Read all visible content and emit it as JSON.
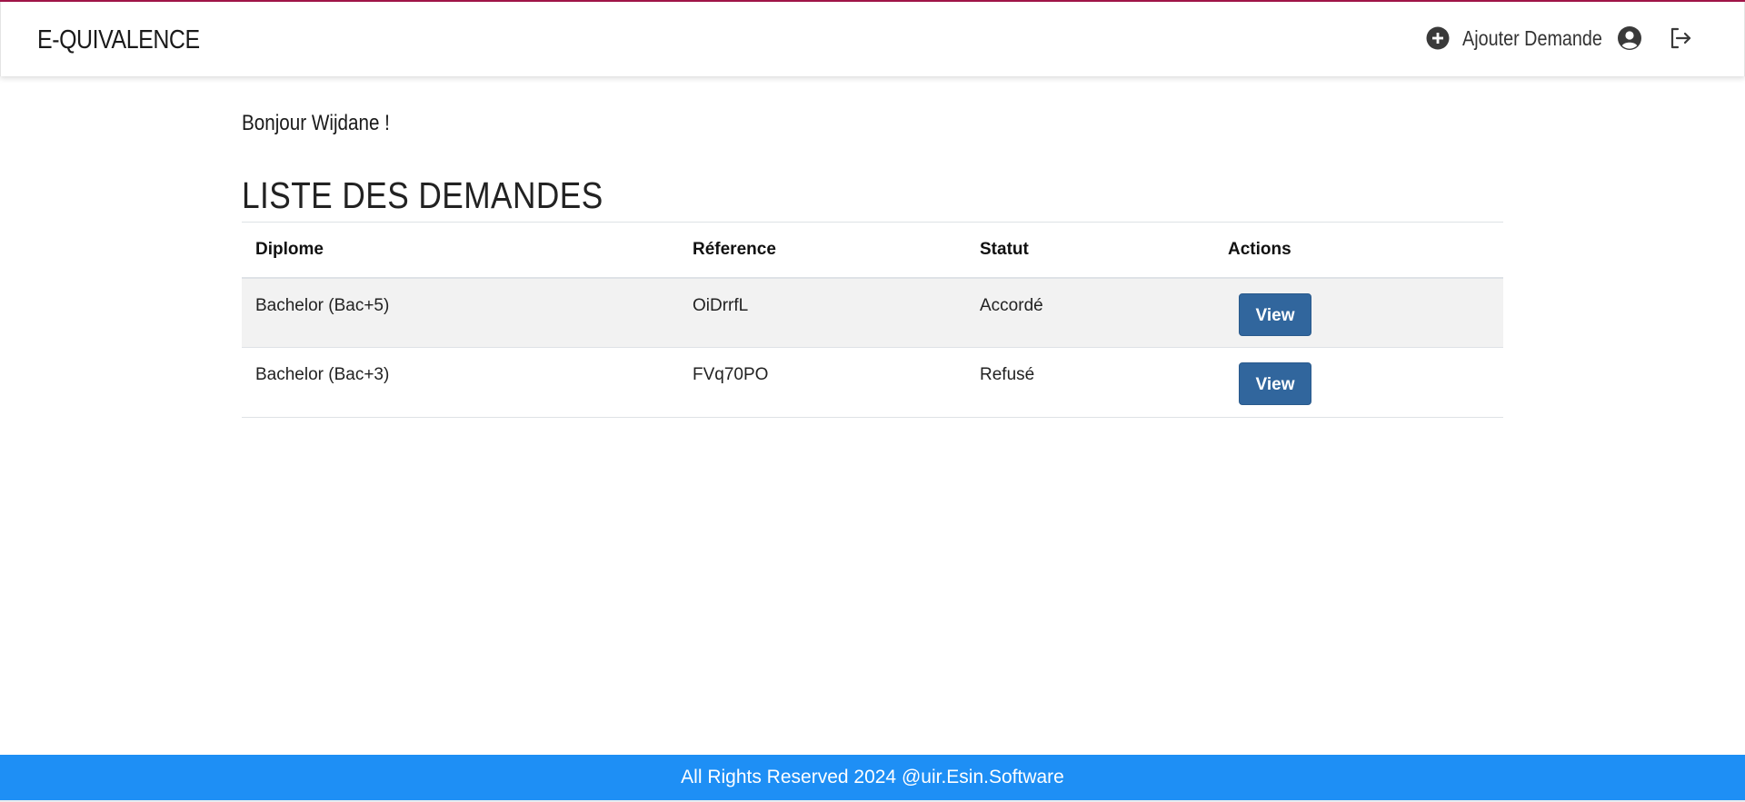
{
  "header": {
    "brand": "E-QUIVALENCE",
    "add_request_label": "Ajouter Demande",
    "icons": [
      "plus-circle-icon",
      "user-circle-icon",
      "logout-icon"
    ]
  },
  "main": {
    "greeting": "Bonjour Wijdane !",
    "title": "LISTE DES DEMANDES",
    "table": {
      "columns": [
        "Diplome",
        "Réference",
        "Statut",
        "Actions"
      ],
      "rows": [
        {
          "diplome": "Bachelor (Bac+5)",
          "reference": "OiDrrfL",
          "statut": "Accordé",
          "action": "View"
        },
        {
          "diplome": "Bachelor (Bac+3)",
          "reference": "FVq70PO",
          "statut": "Refusé",
          "action": "View"
        }
      ]
    }
  },
  "footer": {
    "text": "All Rights Reserved 2024 @uir.Esin.Software"
  },
  "colors": {
    "accent_top": "#a4154a",
    "button": "#31669d",
    "footer": "#1e8ff5"
  }
}
